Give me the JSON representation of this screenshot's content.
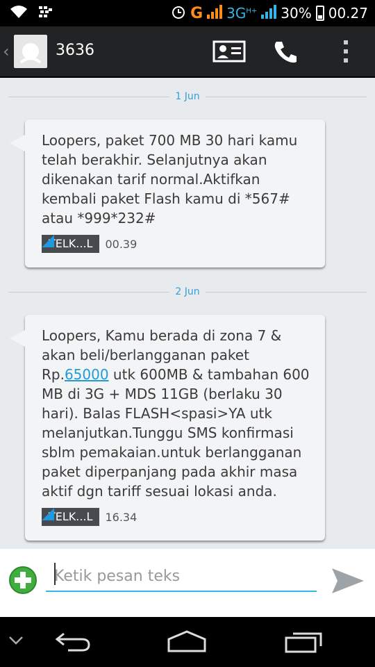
{
  "status_bar": {
    "network_g": "G",
    "network_3g": "3G",
    "network_hplus": "H+",
    "battery": "30%",
    "time": "00.27"
  },
  "header": {
    "contact": "3636"
  },
  "messages": [
    {
      "date": "1 Jun",
      "text": "Loopers, paket 700 MB 30 hari kamu telah berakhir. Selanjutnya akan dikenakan tarif normal.Aktifkan kembali paket Flash kamu di *567# atau *999*232#",
      "sim": "TELK...L",
      "time": "00.39"
    },
    {
      "date": "2 Jun",
      "text_before": "Loopers, Kamu berada di zona 7 & akan beli/berlangganan paket Rp.",
      "link": "65000",
      "text_after": " utk 600MB & tambahan 600 MB di 3G + MDS 11GB (berlaku 30 hari). Balas FLASH<spasi>YA utk melanjutkan.Tunggu SMS konfirmasi sblm pemakaian.untuk berlangganan paket diperpanjang pada akhir masa aktif dgn tariff sesuai lokasi anda.",
      "sim": "TELK...L",
      "time": "16.34"
    }
  ],
  "compose": {
    "placeholder": "Ketik pesan teks"
  },
  "colors": {
    "accent": "#33b5e5",
    "link": "#1f9cd6",
    "network_g": "#ff8a1e"
  }
}
